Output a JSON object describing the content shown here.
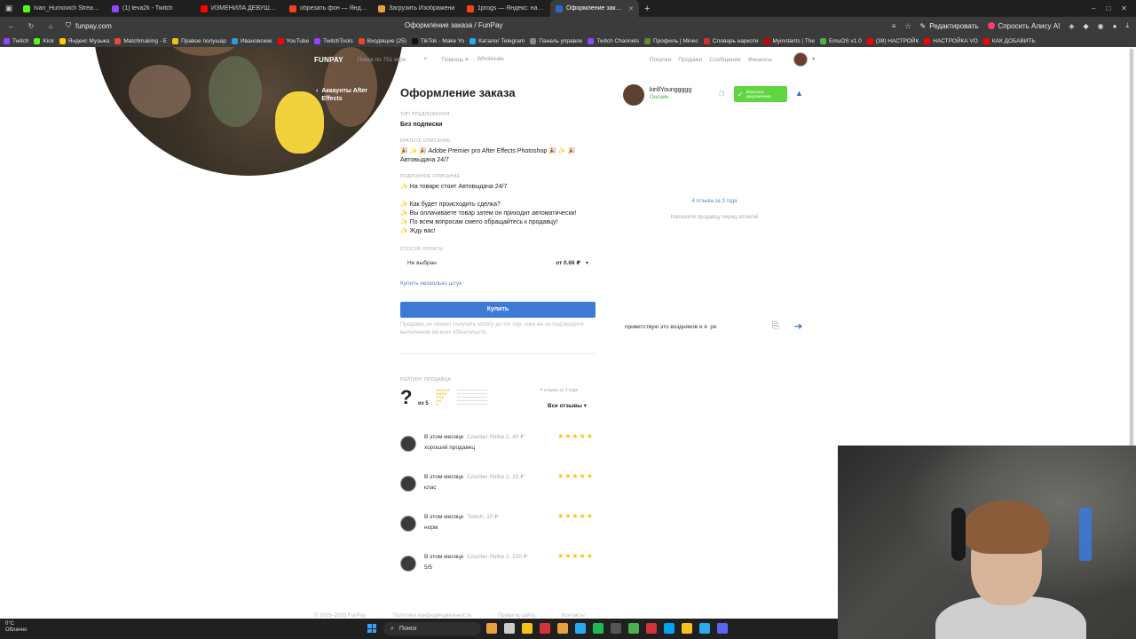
{
  "browser": {
    "tabs": [
      {
        "label": "Ivan_Humovich Stream - Y",
        "color": "#53fc18",
        "active": false
      },
      {
        "label": "(1) leva2k - Twitch",
        "color": "#9146ff",
        "active": false
      },
      {
        "label": "ИЗМЕНИЛА ДЕВУШКА К",
        "color": "#ff0000",
        "active": false
      },
      {
        "label": "обрезать фон — Яндекс",
        "color": "#fc3f1d",
        "active": false
      },
      {
        "label": "Загрузить Изображени",
        "color": "#e8a13c",
        "active": false
      },
      {
        "label": "1progs — Яндекс: нашлос",
        "color": "#fc3f1d",
        "active": false
      },
      {
        "label": "Оформление заказа /",
        "color": "#2d68c4",
        "active": true
      }
    ],
    "url": "funpay.com",
    "page_title": "Оформление заказа / FunPay",
    "edit_label": "Редактировать",
    "alice_label": "Спросить Алису AI",
    "bookmarks": [
      {
        "label": "Twitch",
        "color": "#9146ff"
      },
      {
        "label": "Kick",
        "color": "#53fc18"
      },
      {
        "label": "Яндекс Музыка",
        "color": "#ffcc00"
      },
      {
        "label": "Matchmaking - E",
        "color": "#e74c3c"
      },
      {
        "label": "Правое полушар",
        "color": "#f1c40f"
      },
      {
        "label": "Ивановские",
        "color": "#3498db"
      },
      {
        "label": "YouTube",
        "color": "#ff0000"
      },
      {
        "label": "TwitchTools",
        "color": "#9146ff"
      },
      {
        "label": "Входящие (25)",
        "color": "#ea4335"
      },
      {
        "label": "TikTok - Make Yo",
        "color": "#111111"
      },
      {
        "label": "Каталог Telegram",
        "color": "#2aabee"
      },
      {
        "label": "Панель управле",
        "color": "#888888"
      },
      {
        "label": "Twitch Channels",
        "color": "#9146ff"
      },
      {
        "label": "Профиль | Minec",
        "color": "#5c8a3a"
      },
      {
        "label": "Словарь наркоти",
        "color": "#cc3333"
      },
      {
        "label": "Myinstants | The",
        "color": "#cc0000"
      },
      {
        "label": "EmuOS v1.0",
        "color": "#4caf50"
      },
      {
        "label": "(38) НАСТРОЙК",
        "color": "#ff0000"
      },
      {
        "label": "НАСТРОЙКА VO",
        "color": "#ff0000"
      },
      {
        "label": "КАК ДОБАВИТЬ",
        "color": "#ff0000"
      }
    ]
  },
  "site": {
    "logo": "FUNPAY",
    "search_placeholder": "Поиск по 751 игре",
    "nav_help": "Помощь ▾",
    "nav_wholesale": "Wholesale",
    "nav_right": [
      "Покупки",
      "Продажи",
      "Сообщения",
      "Финансы"
    ]
  },
  "back_link": "Аккаунты After Effects",
  "order": {
    "title": "Оформление заказа",
    "offer_type_label": "ТИП ПРЕДЛОЖЕНИЯ",
    "offer_type_value": "Без подписки",
    "short_desc_label": "КРАТКОЕ ОПИСАНИЕ",
    "short_desc_lines": [
      "🎉 ✨ 🎉 Adobe Premier pro After Effects Photoshop 🎉 ✨ 🎉",
      "Автовыдача 24/7"
    ],
    "full_desc_label": "ПОДРОБНОЕ ОПИСАНИЕ",
    "full_desc_line1": "✨ На товаре стоит Автовыдача 24/7",
    "full_desc_lines": [
      "✨ Как будет происходить сделка?",
      "✨ Вы оплачиваете товар затем он приходит автоматически!",
      "✨ По всем вопросам смело обращайтесь к продавцу!",
      "✨ Жду вас!"
    ],
    "payment_label": "СПОСОБ ОПЛАТЫ",
    "payment_value": "Не выбран",
    "payment_price": "от 0.66 ₽",
    "multi_link": "Купить несколько штук",
    "buy_button": "Купить",
    "buy_note": "Продавец не сможет получить оплату до тех пор, пока вы не подтвердите выполнение им всех обязательств."
  },
  "rating": {
    "label": "РЕЙТИНГ ПРОДАВЦА",
    "score": "?",
    "of": "из 5",
    "count": "4 отзыва за 3 года",
    "all_reviews": "Все отзывы ▾"
  },
  "reviews": [
    {
      "when": "В этом месяце",
      "game": "Counter-Strike 2, 40 ₽",
      "text": "хороший продавец",
      "stars": "★★★★★"
    },
    {
      "when": "В этом месяце",
      "game": "Counter-Strike 2, 10 ₽",
      "text": "клас",
      "stars": "★★★★★"
    },
    {
      "when": "В этом месяце",
      "game": "Twitch, 10 ₽",
      "text": "норм",
      "stars": "★★★★★"
    },
    {
      "when": "В этом месяце",
      "game": "Counter-Strike 2, 100 ₽",
      "text": "5/5",
      "stars": "★★★★★"
    }
  ],
  "chat": {
    "username": "kirillYounggggg",
    "status": "Онлайн",
    "green_button": "Включить уведомления",
    "empty_count": "4 отзыва за 3 года",
    "empty_hint": "Напишите продавцу перед оплатой",
    "input_value": "приветствую это воздняков и я  ре"
  },
  "footer": {
    "copyright": "© 2016–2025 FunPay",
    "links": [
      "Политика конфиденциальности",
      "Правила сайта",
      "Контакты"
    ]
  },
  "taskbar": {
    "weather_temp": "0°C",
    "weather_desc": "Облачно",
    "search_label": "Поиск",
    "app_colors": [
      "#e8a13c",
      "#cccccc",
      "#f4c21b",
      "#d13438",
      "#e8a13c",
      "#2aabee",
      "#1db954",
      "#555555",
      "#4caf50",
      "#d13438",
      "#00a4ef",
      "#f4c21b",
      "#2aabee",
      "#5865f2"
    ]
  }
}
